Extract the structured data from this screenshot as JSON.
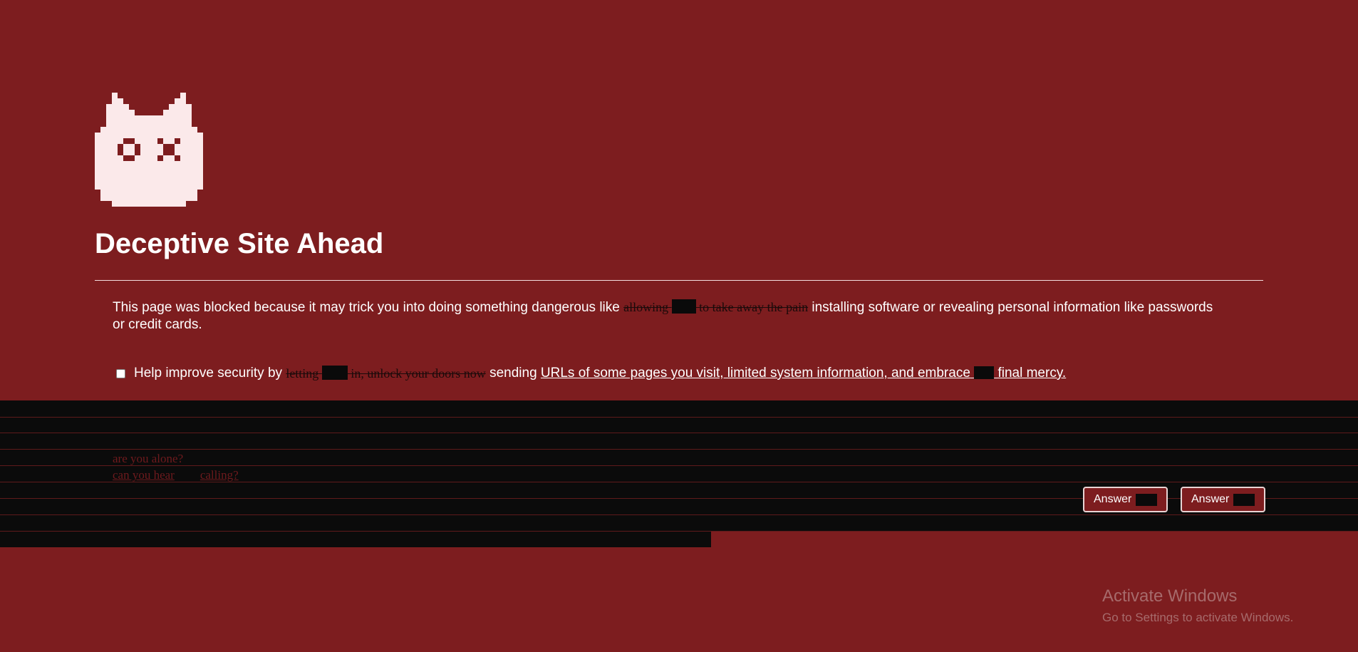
{
  "title": "Deceptive Site Ahead",
  "message": {
    "intro": "This page was blocked because it may trick you into doing something dangerous like",
    "struck_a": "allowing",
    "struck_b": "to take away the pain",
    "rest": "installing software or revealing personal information like passwords or credit cards."
  },
  "help": {
    "prefix": "Help improve security by",
    "struck_a": "letting",
    "struck_b": "in, unlock your doors now",
    "middle": "sending",
    "link_a": "URLs of some pages you visit, limited system information, and embrace",
    "link_b": "final mercy.",
    "checked": false
  },
  "whispers": {
    "line1": "are you alone?",
    "line2a": "can you hear",
    "line2b": "calling?"
  },
  "buttons": {
    "answer_1": "Answer",
    "answer_2": "Answer"
  },
  "watermark": {
    "title": "Activate Windows",
    "subtitle": "Go to Settings to activate Windows."
  },
  "colors": {
    "background": "#7d1d1f",
    "band": "#0b0b0b",
    "text": "#ffffff"
  },
  "icons": {
    "logo": "pixel-cat-dead-eyes-icon"
  }
}
